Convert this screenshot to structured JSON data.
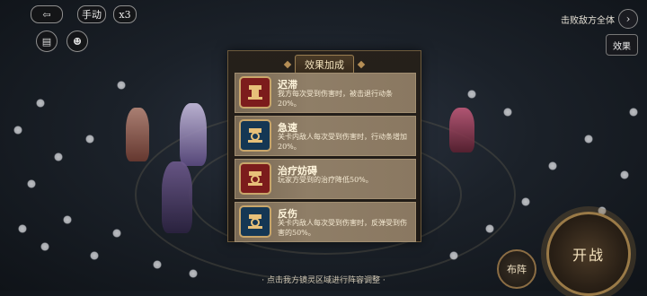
{
  "controls": {
    "back_label": "",
    "auto_label": "手动",
    "speed_label": "x3",
    "chat_icon": "chat-icon",
    "social_icon": "friend-icon"
  },
  "top_right": {
    "victory_condition": "击败敌方全体",
    "effect_button": "效果"
  },
  "panel": {
    "title": "效果加成",
    "effects": [
      {
        "name": "迟滞",
        "desc": "我方每次受到伤害时，被击退行动条20%。",
        "type": "debuff"
      },
      {
        "name": "急速",
        "desc": "关卡内敌人每次受到伤害时，行动条增加20%。",
        "type": "buff"
      },
      {
        "name": "治疗妨碍",
        "desc": "玩家方受到的治疗降低50%。",
        "type": "debuff"
      },
      {
        "name": "反伤",
        "desc": "关卡内敌人每次受到伤害时，反弹受到伤害的50%。",
        "type": "buff"
      }
    ]
  },
  "bottom": {
    "hint": "· 点击我方镜灵区域进行阵容调整 ·",
    "formation_button": "布阵",
    "start_button": "开战"
  },
  "colors": {
    "debuff_icon": "#7c1c1c",
    "buff_icon": "#153754",
    "panel_border": "#6d5a3c",
    "gold": "#c9a66a"
  }
}
